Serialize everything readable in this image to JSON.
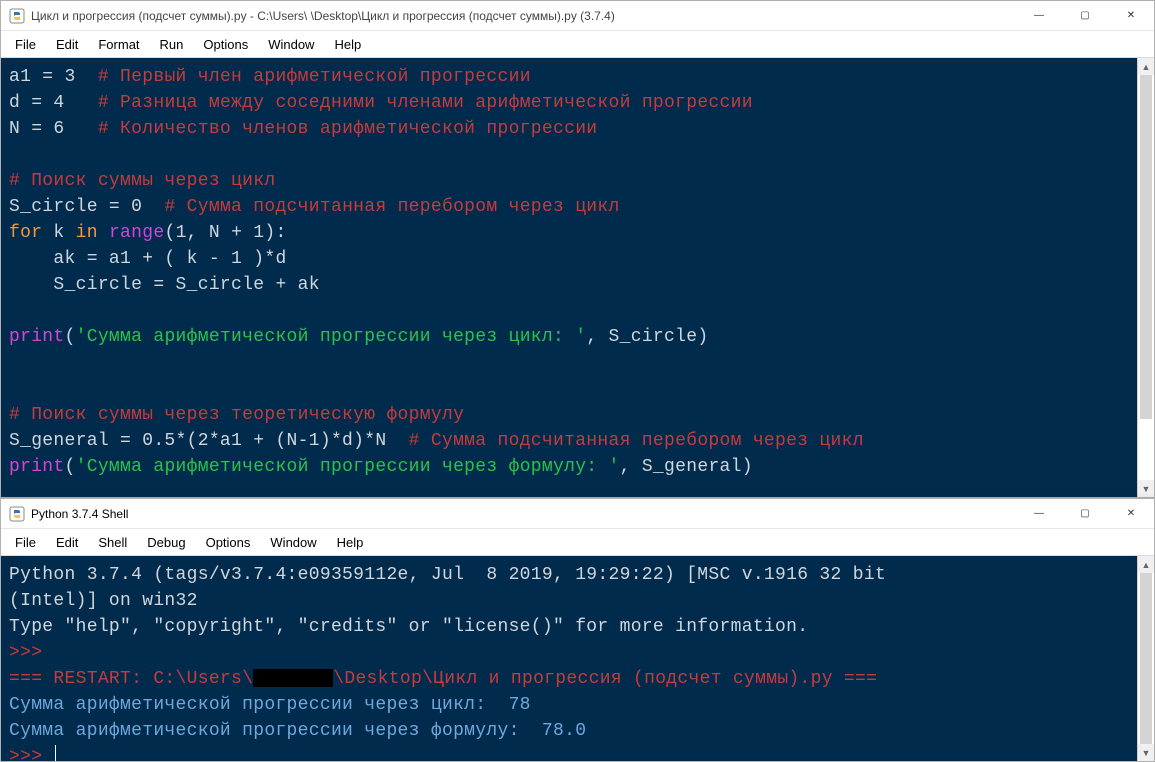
{
  "editor": {
    "title": "Цикл и прогрессия (подсчет суммы).py - C:\\Users\\        \\Desktop\\Цикл и прогрессия (подсчет суммы).py (3.7.4)",
    "menus": {
      "file": "File",
      "edit": "Edit",
      "format": "Format",
      "run": "Run",
      "options": "Options",
      "window": "Window",
      "help": "Help"
    },
    "code": {
      "l1a": "a1 = 3  ",
      "l1c": "# Первый член арифметической прогрессии",
      "l2a": "d = 4   ",
      "l2c": "# Разница между соседними членами арифметической прогрессии",
      "l3a": "N = 6   ",
      "l3c": "# Количество членов арифметической прогрессии",
      "l4": "",
      "l5c": "# Поиск суммы через цикл",
      "l6a": "S_circle = 0  ",
      "l6c": "# Сумма подсчитанная перебором через цикл",
      "l7_for": "for ",
      "l7_k": "k ",
      "l7_in": "in ",
      "l7_range": "range",
      "l7_tail": "(1, N + 1):",
      "l8": "    ak = a1 + ( k - 1 )*d",
      "l9": "    S_circle = S_circle + ak",
      "l10": "",
      "l11_print": "print",
      "l11_open": "(",
      "l11_str": "'Сумма арифметической прогрессии через цикл: '",
      "l11_tail": ", S_circle)",
      "l12": "",
      "l13": "",
      "l14c": "# Поиск суммы через теоретическую формулу",
      "l15a": "S_general = 0.5*(2*a1 + (N-1)*d)*N  ",
      "l15c": "# Сумма подсчитанная перебором через цикл",
      "l16_print": "print",
      "l16_open": "(",
      "l16_str": "'Сумма арифметической прогрессии через формулу: '",
      "l16_tail": ", S_general)"
    }
  },
  "shell": {
    "title": "Python 3.7.4 Shell",
    "menus": {
      "file": "File",
      "edit": "Edit",
      "shell": "Shell",
      "debug": "Debug",
      "options": "Options",
      "window": "Window",
      "help": "Help"
    },
    "lines": {
      "banner1": "Python 3.7.4 (tags/v3.7.4:e09359112e, Jul  8 2019, 19:29:22) [MSC v.1916 32 bit ",
      "banner2": "(Intel)] on win32",
      "banner3": "Type \"help\", \"copyright\", \"credits\" or \"license()\" for more information.",
      "prompt": ">>> ",
      "restart_pre": "=== RESTART: C:\\Users\\",
      "restart_post": "\\Desktop\\Цикл и прогрессия (подсчет суммы).py ===",
      "out1": "Сумма арифметической прогрессии через цикл:  78",
      "out2": "Сумма арифметической прогрессии через формулу:  78.0",
      "prompt2": ">>> "
    }
  },
  "win_controls": {
    "min": "—",
    "max": "▢",
    "close": "✕"
  },
  "scrollbar": {
    "up": "▲",
    "down": "▼"
  }
}
